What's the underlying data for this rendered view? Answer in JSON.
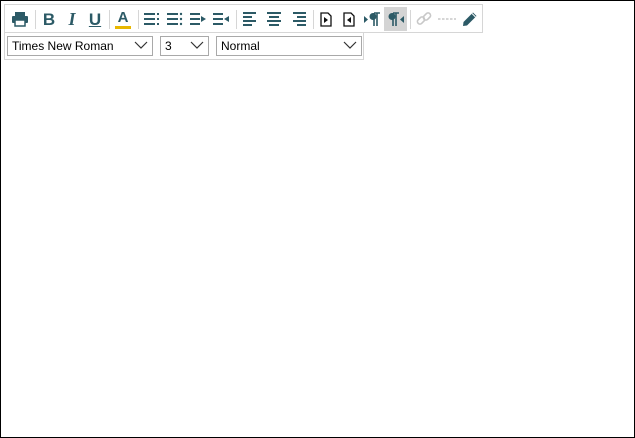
{
  "toolbar": {
    "buttons": [
      {
        "name": "print-icon",
        "tooltip": ""
      },
      {
        "name": "bold-icon",
        "glyph": "B"
      },
      {
        "name": "italic-icon",
        "glyph": "I"
      },
      {
        "name": "underline-icon",
        "glyph": "U"
      },
      {
        "name": "font-color-icon",
        "glyph": "A"
      },
      {
        "name": "ordered-list-icon"
      },
      {
        "name": "unordered-list-icon"
      },
      {
        "name": "indent-icon"
      },
      {
        "name": "outdent-icon"
      },
      {
        "name": "align-left-icon"
      },
      {
        "name": "align-center-icon"
      },
      {
        "name": "align-right-icon"
      },
      {
        "name": "insert-before-icon"
      },
      {
        "name": "insert-after-icon"
      },
      {
        "name": "ltr-paragraph-icon"
      },
      {
        "name": "rtl-paragraph-icon",
        "active": true
      },
      {
        "name": "link-icon",
        "disabled": true
      },
      {
        "name": "horizontal-rule-icon",
        "disabled": true
      },
      {
        "name": "pencil-icon"
      }
    ],
    "bold_label": "B",
    "italic_label": "I",
    "underline_label": "U",
    "font_color_label": "A",
    "accent_color": "#2c5a66",
    "font_color_underline": "#e8b700",
    "disabled_color": "#c8c8c8"
  },
  "format": {
    "font_family": "Times New Roman",
    "font_size": "3",
    "block_style": "Normal"
  }
}
